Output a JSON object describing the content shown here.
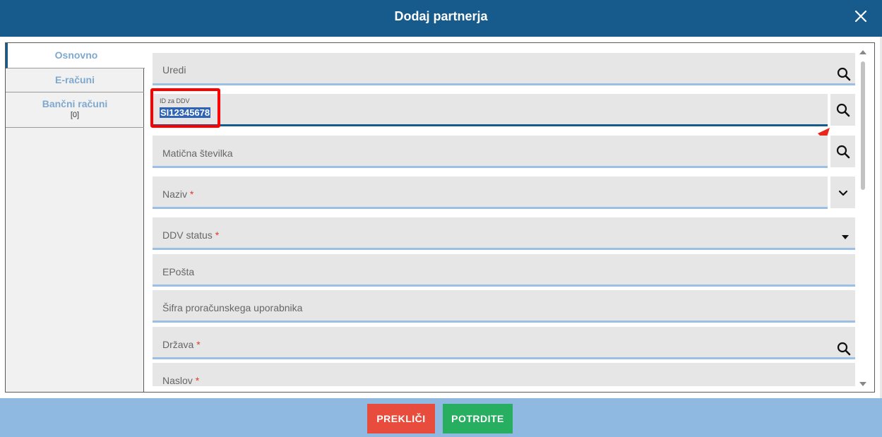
{
  "dialog": {
    "title": "Dodaj partnerja"
  },
  "tabs": [
    {
      "label": "Osnovno"
    },
    {
      "label": "E-računi"
    },
    {
      "label": "Bančni računi",
      "count": "[0]"
    }
  ],
  "fields": {
    "uredi": {
      "label": "Uredi"
    },
    "id_ddv": {
      "label": "ID za DDV",
      "value": "SI12345678"
    },
    "maticna": {
      "label": "Matična številka"
    },
    "naziv": {
      "label": "Naziv",
      "required": "*"
    },
    "ddv_status": {
      "label": "DDV status",
      "required": "*"
    },
    "eposta": {
      "label": "EPošta"
    },
    "sifra": {
      "label": "Šifra proračunskega uporabnika"
    },
    "drzava": {
      "label": "Država",
      "required": "*"
    },
    "naslov": {
      "label": "Naslov",
      "required": "*"
    }
  },
  "buttons": {
    "cancel": "PREKLIČI",
    "confirm": "POTRDITE"
  },
  "colors": {
    "header": "#175a8c",
    "footer": "#8fb9e0",
    "cancel": "#e74c3c",
    "confirm": "#27ae60",
    "highlight": "#ff0000",
    "accent": "#9cc0e4"
  },
  "icons": {
    "close": "close-icon",
    "search": "search-icon",
    "chevron": "chevron-down-icon",
    "caret": "caret-down-icon",
    "arrow": "red-arrow-annotation"
  }
}
